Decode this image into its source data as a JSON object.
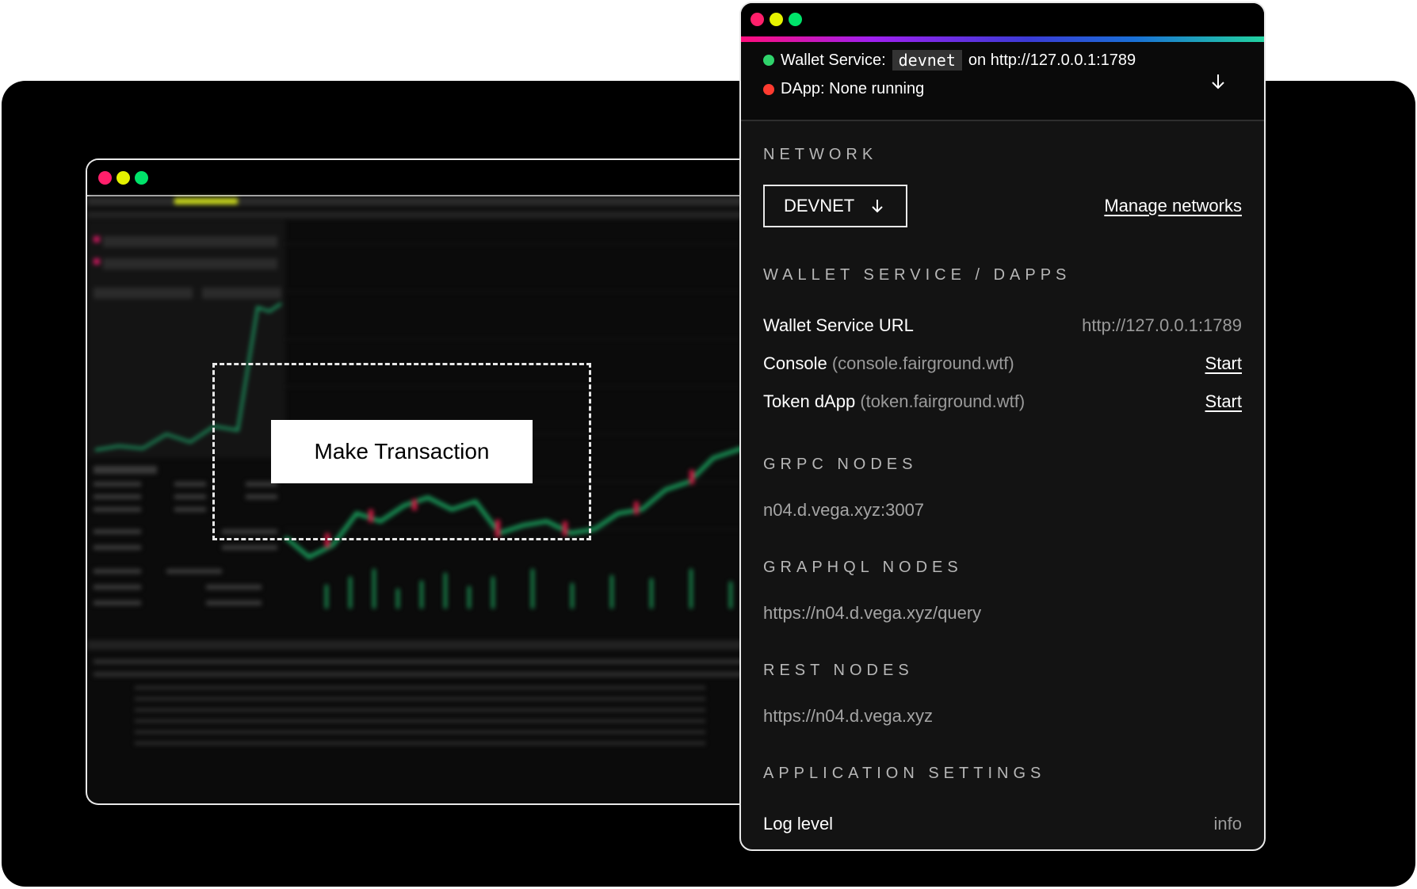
{
  "back_window": {
    "action_button_label": "Make Transaction"
  },
  "wallet": {
    "status": {
      "service_label": "Wallet Service:",
      "network_code": "devnet",
      "service_url_text": "on http://127.0.0.1:1789",
      "service_status_color": "#2fd36b",
      "dapp_text": "DApp: None running",
      "dapp_status_color": "#ff3b30"
    },
    "network": {
      "heading": "NETWORK",
      "selected": "DEVNET",
      "manage_link": "Manage networks"
    },
    "services": {
      "heading": "WALLET SERVICE / DAPPS",
      "rows": [
        {
          "label": "Wallet Service URL",
          "sub": "",
          "value": "http://127.0.0.1:1789"
        },
        {
          "label": "Console",
          "sub": "(console.fairground.wtf)",
          "action": "Start"
        },
        {
          "label": "Token dApp",
          "sub": "(token.fairground.wtf)",
          "action": "Start"
        }
      ]
    },
    "grpc": {
      "heading": "GRPC NODES",
      "value": "n04.d.vega.xyz:3007"
    },
    "graphql": {
      "heading": "GRAPHQL NODES",
      "value": "https://n04.d.vega.xyz/query"
    },
    "rest": {
      "heading": "REST NODES",
      "value": "https://n04.d.vega.xyz"
    },
    "app_settings": {
      "heading": "APPLICATION SETTINGS",
      "log_level_label": "Log level",
      "log_level_value": "info"
    }
  },
  "colors": {
    "dot_red": "#ff1f6b",
    "dot_yellow": "#e5f200",
    "dot_green": "#00e36a"
  }
}
